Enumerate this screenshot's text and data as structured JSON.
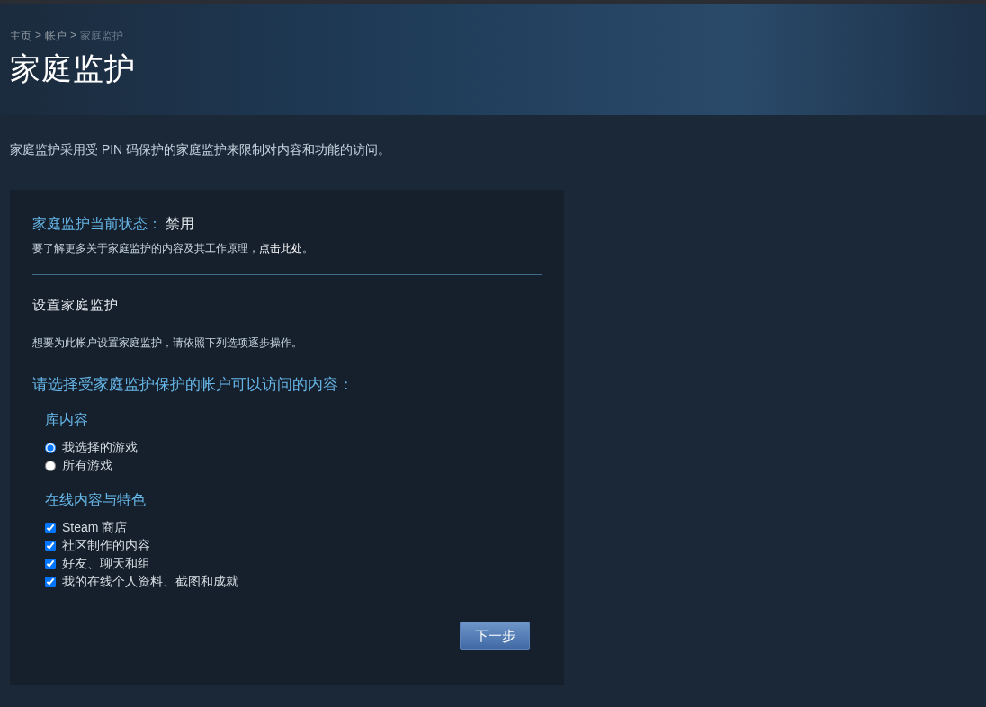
{
  "breadcrumb": {
    "items": [
      "主页",
      "帐户",
      "家庭监护"
    ],
    "separators": [
      ">",
      ">"
    ]
  },
  "page_title": "家庭监护",
  "intro": "家庭监护采用受 PIN 码保护的家庭监护来限制对内容和功能的访问。",
  "panel": {
    "status_label": "家庭监护当前状态：",
    "status_value": "禁用",
    "learn_more": {
      "text": "要了解更多关于家庭监护的内容及其工作原理，",
      "link": "点击此处",
      "suffix": "。"
    },
    "setup_title": "设置家庭监护",
    "setup_hint": "想要为此帐户设置家庭监护，请依照下列选项逐步操作。",
    "question": "请选择受家庭监护保护的帐户可以访问的内容：",
    "groups": [
      {
        "title": "库内容",
        "kind": "radio",
        "options": [
          {
            "label": "我选择的游戏",
            "selected": true
          },
          {
            "label": "所有游戏",
            "selected": false
          }
        ]
      },
      {
        "title": "在线内容与特色",
        "kind": "checkbox",
        "options": [
          {
            "label": "Steam 商店",
            "checked": true
          },
          {
            "label": "社区制作的内容",
            "checked": true
          },
          {
            "label": "好友、聊天和组",
            "checked": true
          },
          {
            "label": "我的在线个人资料、截图和成就",
            "checked": true
          }
        ]
      }
    ],
    "next_button": "下一步"
  }
}
